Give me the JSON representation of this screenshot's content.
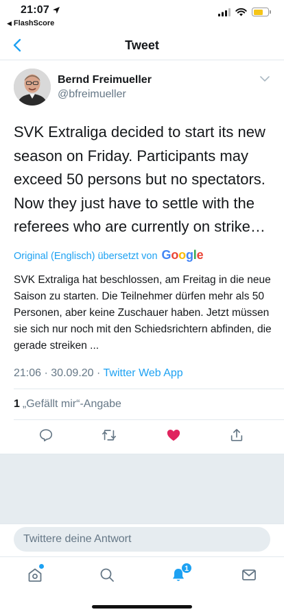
{
  "status_bar": {
    "time": "21:07",
    "back_app": "FlashScore",
    "battery_color": "#f5c518"
  },
  "nav": {
    "title": "Tweet",
    "back_icon": "chevron-left-icon"
  },
  "tweet": {
    "author_name": "Bernd Freimueller",
    "author_handle": "@bfreimueller",
    "text": "SVK Extraliga decided to start its new season on Friday. Participants may exceed 50 persons but no spectators. Now they just have to settle with the referees who are currently on strike…",
    "translation_label": "Original (Englisch) übersetzt von",
    "translation_brand": "Google",
    "translated_text": "SVK Extraliga hat beschlossen, am Freitag in die neue Saison zu starten. Die Teilnehmer dürfen mehr als 50 Personen, aber keine Zuschauer haben. Jetzt müssen sie sich nur noch mit den Schiedsrichtern abfinden, die gerade streiken ...",
    "time": "21:06",
    "date": "30.09.20",
    "via": "Twitter Web App",
    "like_count": "1",
    "like_label": "„Gefällt mir“-Angabe"
  },
  "actions": [
    {
      "icon": "reply-icon"
    },
    {
      "icon": "retweet-icon"
    },
    {
      "icon": "heart-filled-icon",
      "color": "#e0245e"
    },
    {
      "icon": "share-icon"
    }
  ],
  "reply": {
    "placeholder": "Twittere deine Antwort"
  },
  "tabbar": {
    "notification_badge": "1",
    "accent": "#1da1f2",
    "tabs": [
      {
        "icon": "home-icon"
      },
      {
        "icon": "search-icon"
      },
      {
        "icon": "bell-icon"
      },
      {
        "icon": "mail-icon"
      }
    ]
  }
}
